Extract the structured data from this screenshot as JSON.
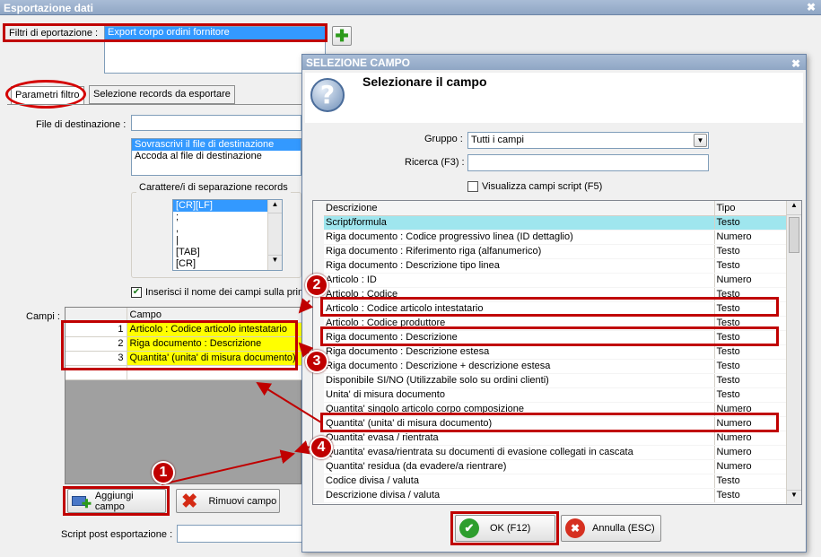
{
  "window": {
    "title": "Esportazione dati"
  },
  "filters": {
    "label": "Filtri di eportazione :",
    "value": "Export corpo ordini fornitore"
  },
  "tabs": [
    {
      "label": "Parametri filtro",
      "active": true
    },
    {
      "label": "Selezione records da esportare",
      "active": false
    }
  ],
  "destination": {
    "label": "File di destinazione :",
    "options": [
      "Sovrascrivi il file di destinazione",
      "Accoda al file di destinazione"
    ],
    "selected_index": 0
  },
  "separator": {
    "group_label": "Carattere/i di separazione records",
    "options": [
      "[CR][LF]",
      ";",
      ",",
      "|",
      "[TAB]",
      "[CR]"
    ],
    "selected_index": 0
  },
  "insert_names": {
    "label": "Inserisci il nome dei campi sulla prima",
    "checked": true
  },
  "fields": {
    "label": "Campi :",
    "column_header": "Campo",
    "rows": [
      {
        "num": "1",
        "campo": "Articolo : Codice articolo intestatario"
      },
      {
        "num": "2",
        "campo": "Riga documento : Descrizione"
      },
      {
        "num": "3",
        "campo": "Quantita' (unita' di misura documento)"
      }
    ]
  },
  "buttons": {
    "add": "Aggiungi campo",
    "remove": "Rimuovi campo"
  },
  "script_post": {
    "label": "Script post esportazione :"
  },
  "dialog": {
    "title": "SELEZIONE CAMPO",
    "heading": "Selezionare il campo",
    "gruppo_label": "Gruppo :",
    "gruppo_value": "Tutti i campi",
    "ricerca_label": "Ricerca (F3) :",
    "show_script_label": "Visualizza campi script (F5)",
    "col_descrizione": "Descrizione",
    "col_tipo": "Tipo",
    "rows": [
      {
        "d": "Script/formula",
        "t": "Testo"
      },
      {
        "d": "Riga documento : Codice progressivo linea (ID dettaglio)",
        "t": "Numero"
      },
      {
        "d": "Riga documento : Riferimento riga (alfanumerico)",
        "t": "Testo"
      },
      {
        "d": "Riga documento : Descrizione tipo linea",
        "t": "Testo"
      },
      {
        "d": "Articolo : ID",
        "t": "Numero"
      },
      {
        "d": "Articolo : Codice",
        "t": "Testo"
      },
      {
        "d": "Articolo : Codice articolo intestatario",
        "t": "Testo"
      },
      {
        "d": "Articolo : Codice produttore",
        "t": "Testo"
      },
      {
        "d": "Riga documento : Descrizione",
        "t": "Testo"
      },
      {
        "d": "Riga documento : Descrizione estesa",
        "t": "Testo"
      },
      {
        "d": "Riga documento : Descrizione + descrizione estesa",
        "t": "Testo"
      },
      {
        "d": "Disponibile SI/NO (Utilizzabile solo su ordini clienti)",
        "t": "Testo"
      },
      {
        "d": "Unita' di misura documento",
        "t": "Testo"
      },
      {
        "d": "Quantita' singolo articolo corpo composizione",
        "t": "Numero"
      },
      {
        "d": "Quantita' (unita' di misura documento)",
        "t": "Numero"
      },
      {
        "d": "Quantita' evasa / rientrata",
        "t": "Numero"
      },
      {
        "d": "Quantita' evasa/rientrata su documenti di evasione collegati in cascata",
        "t": "Numero"
      },
      {
        "d": "Quantita' residua (da evadere/a rientrare)",
        "t": "Numero"
      },
      {
        "d": "Codice divisa / valuta",
        "t": "Testo"
      },
      {
        "d": "Descrizione divisa / valuta",
        "t": "Testo"
      }
    ],
    "ok_label": "OK (F12)",
    "cancel_label": "Annulla (ESC)"
  },
  "annotations": [
    "1",
    "2",
    "3",
    "4"
  ],
  "colors": {
    "annotation": "#c00000",
    "highlight": "#ffff00",
    "selected_row": "#9fe6ee",
    "list_selection": "#3399ff"
  }
}
